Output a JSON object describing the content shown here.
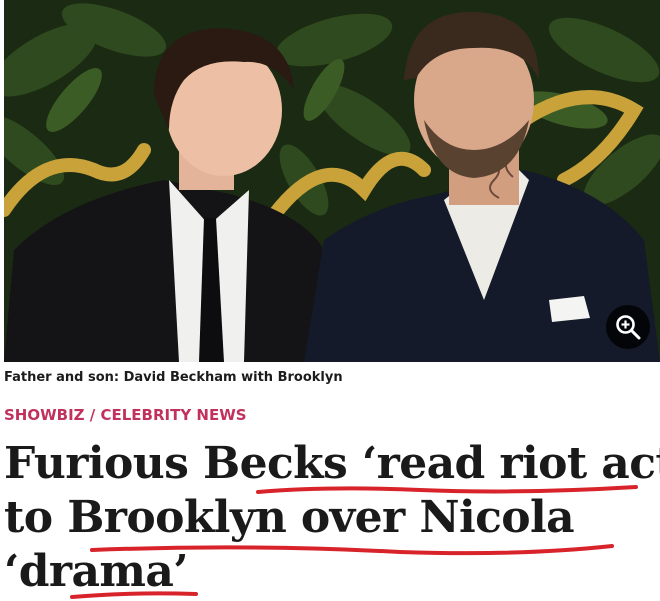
{
  "photo": {
    "alt_icon": "celebrity-photo",
    "zoom_icon": "zoom-in-icon"
  },
  "caption": {
    "text": "Father and son: David Beckham with Brooklyn"
  },
  "section": {
    "label": "SHOWBIZ / CELEBRITY NEWS"
  },
  "headline": {
    "line1": "Furious Becks ‘read riot act’",
    "line2": "to Brooklyn over Nicola",
    "line3": "‘drama’"
  },
  "colors": {
    "section": "#c0325d",
    "annotation": "#d9232b",
    "headline": "#1a1a1a"
  }
}
